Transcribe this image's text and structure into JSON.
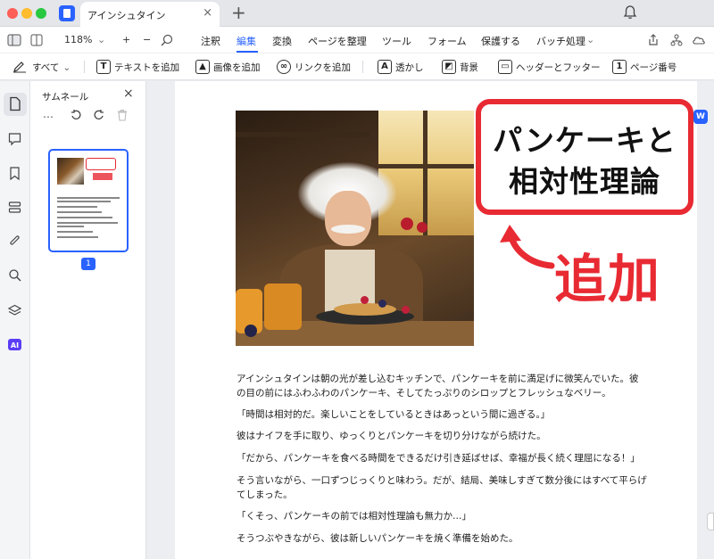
{
  "window": {
    "tab_title": "アインシュタイン",
    "tab_close": "×",
    "tab_add": "+"
  },
  "toolbar1": {
    "zoom": "118%",
    "zoom_in": "+",
    "zoom_out": "−",
    "menus": [
      {
        "label": "注釈"
      },
      {
        "label": "編集"
      },
      {
        "label": "変換"
      },
      {
        "label": "ページを整理"
      },
      {
        "label": "ツール"
      },
      {
        "label": "フォーム"
      },
      {
        "label": "保護する"
      },
      {
        "label": "バッチ処理"
      }
    ],
    "active_menu": "編集"
  },
  "toolbar2": {
    "all_label": "すべて",
    "items": [
      {
        "label": "テキストを追加",
        "icon": "text-box-icon"
      },
      {
        "label": "画像を追加",
        "icon": "image-icon"
      },
      {
        "label": "リンクを追加",
        "icon": "link-icon"
      },
      {
        "label": "透かし",
        "icon": "watermark-icon"
      },
      {
        "label": "背景",
        "icon": "background-icon"
      },
      {
        "label": "ヘッダーとフッター",
        "icon": "header-footer-icon"
      },
      {
        "label": "ページ番号",
        "icon": "page-number-icon"
      }
    ]
  },
  "thumbnails": {
    "title": "サムネール",
    "close": "×",
    "tools": "…",
    "page_number": "1"
  },
  "document": {
    "callout_line1": "パンケーキと",
    "callout_line2": "相対性理論",
    "added_label": "追加",
    "paragraphs": [
      "アインシュタインは朝の光が差し込むキッチンで、パンケーキを前に満足げに微笑んでいた。彼の目の前にはふわふわのパンケーキ、そしてたっぷりのシロップとフレッシュなベリー。",
      "「時間は相対的だ。楽しいことをしているときはあっという間に過ぎる。」",
      "彼はナイフを手に取り、ゆっくりとパンケーキを切り分けながら続けた。",
      "「だから、パンケーキを食べる時間をできるだけ引き延ばせば、幸福が長く続く理屈になる！」",
      "そう言いながら、一口ずつじっくりと味わう。だが、結局、美味しすぎて数分後にはすべて平らげてしまった。",
      "「くそっ、パンケーキの前では相対性理論も無力か…」",
      "そうつぶやきながら、彼は新しいパンケーキを焼く準備を始めた。"
    ]
  },
  "colors": {
    "accent": "#2962ff",
    "callout_red": "#e82a33"
  }
}
